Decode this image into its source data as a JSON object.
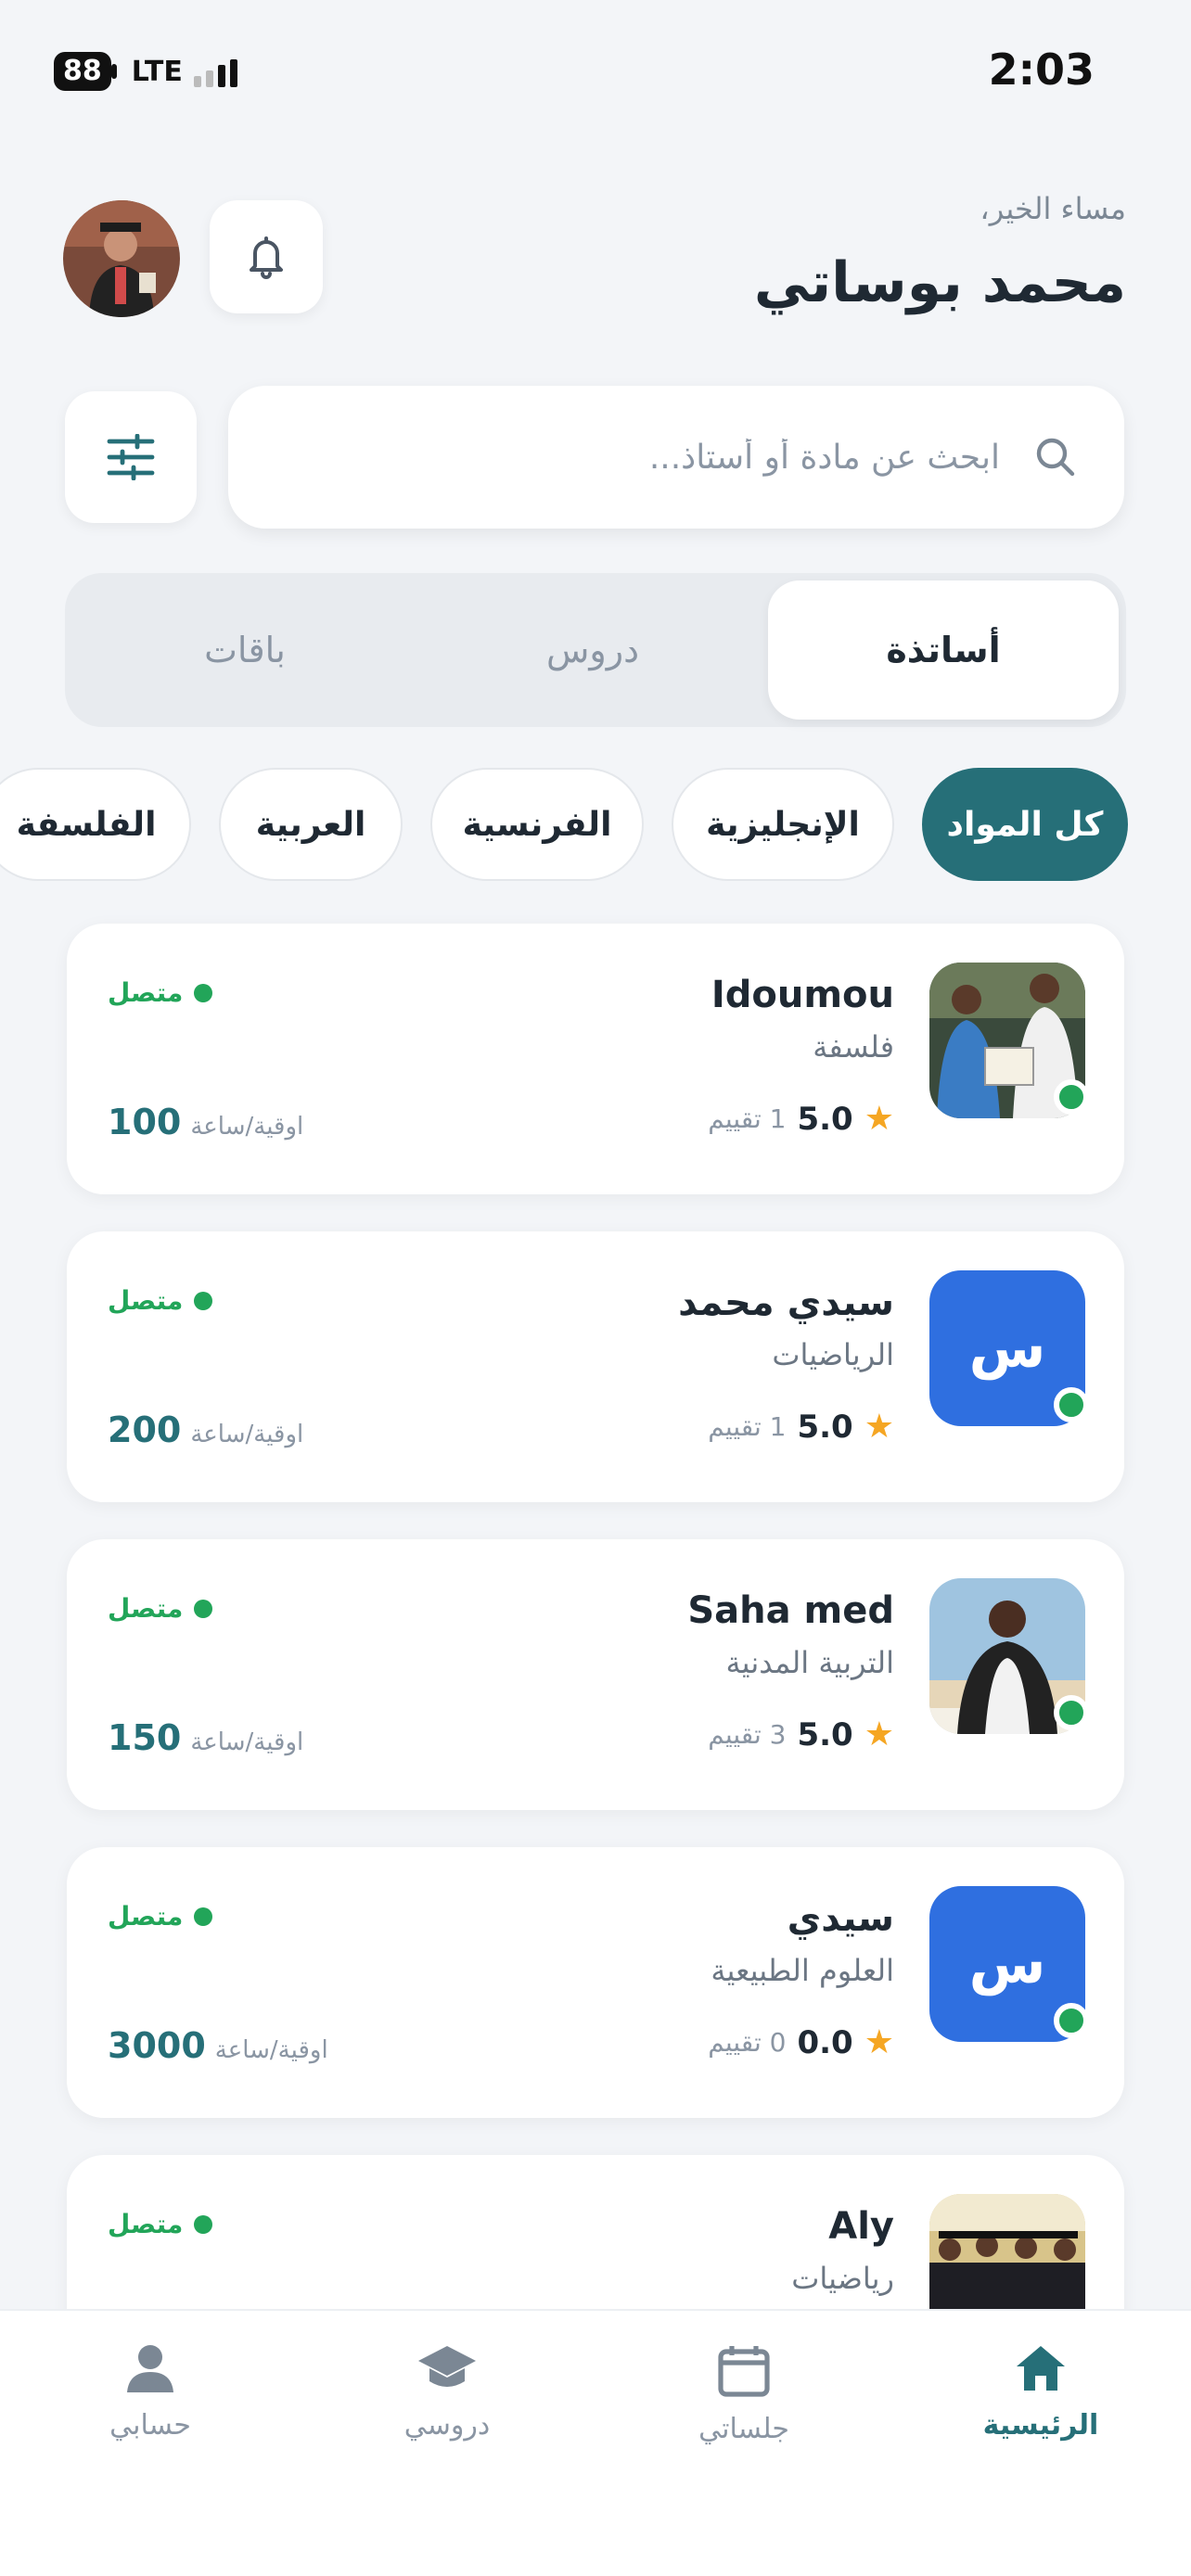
{
  "status_bar": {
    "time": "2:03",
    "battery": "88",
    "network": "LTE"
  },
  "header": {
    "greeting": "مساء الخير،",
    "user_name": "محمد بوساتي"
  },
  "search": {
    "placeholder": "ابحث عن مادة أو أستاذ..."
  },
  "tabs": [
    {
      "label": "أساتذة",
      "active": true
    },
    {
      "label": "دروس",
      "active": false
    },
    {
      "label": "باقات",
      "active": false
    }
  ],
  "chips": [
    {
      "label": "كل المواد",
      "active": true
    },
    {
      "label": "الإنجليزية",
      "active": false
    },
    {
      "label": "الفرنسية",
      "active": false
    },
    {
      "label": "العربية",
      "active": false
    },
    {
      "label": "الفلسفة",
      "active": false
    }
  ],
  "teachers": [
    {
      "name": "Idoumou",
      "subject": "فلسفة",
      "rating": "5.0",
      "reviews": "1 تقييم",
      "status": "متصل",
      "price": "100",
      "price_unit": "اوقية/ساعة",
      "avatar": "photo"
    },
    {
      "name": "سيدي محمد",
      "subject": "الرياضيات",
      "rating": "5.0",
      "reviews": "1 تقييم",
      "status": "متصل",
      "price": "200",
      "price_unit": "اوقية/ساعة",
      "avatar": "initial",
      "initial": "س"
    },
    {
      "name": "Saha med",
      "subject": "التربية المدنية",
      "rating": "5.0",
      "reviews": "3 تقييم",
      "status": "متصل",
      "price": "150",
      "price_unit": "اوقية/ساعة",
      "avatar": "photo"
    },
    {
      "name": "سيدي",
      "subject": "العلوم الطبيعية",
      "rating": "0.0",
      "reviews": "0 تقييم",
      "status": "متصل",
      "price": "3000",
      "price_unit": "اوقية/ساعة",
      "avatar": "initial",
      "initial": "س"
    },
    {
      "name": "Aly",
      "subject": "رياضيات",
      "rating": "",
      "reviews": "",
      "status": "متصل",
      "price": "",
      "price_unit": "",
      "avatar": "photo"
    }
  ],
  "nav": [
    {
      "label": "الرئيسية",
      "icon": "home-icon",
      "active": true
    },
    {
      "label": "جلساتي",
      "icon": "calendar-icon",
      "active": false
    },
    {
      "label": "دروسي",
      "icon": "graduation-cap-icon",
      "active": false
    },
    {
      "label": "حسابي",
      "icon": "user-icon",
      "active": false
    }
  ],
  "colors": {
    "primary": "#266f78",
    "online": "#22a559",
    "initial_bg": "#2f6fe0",
    "star": "#f5a623"
  }
}
